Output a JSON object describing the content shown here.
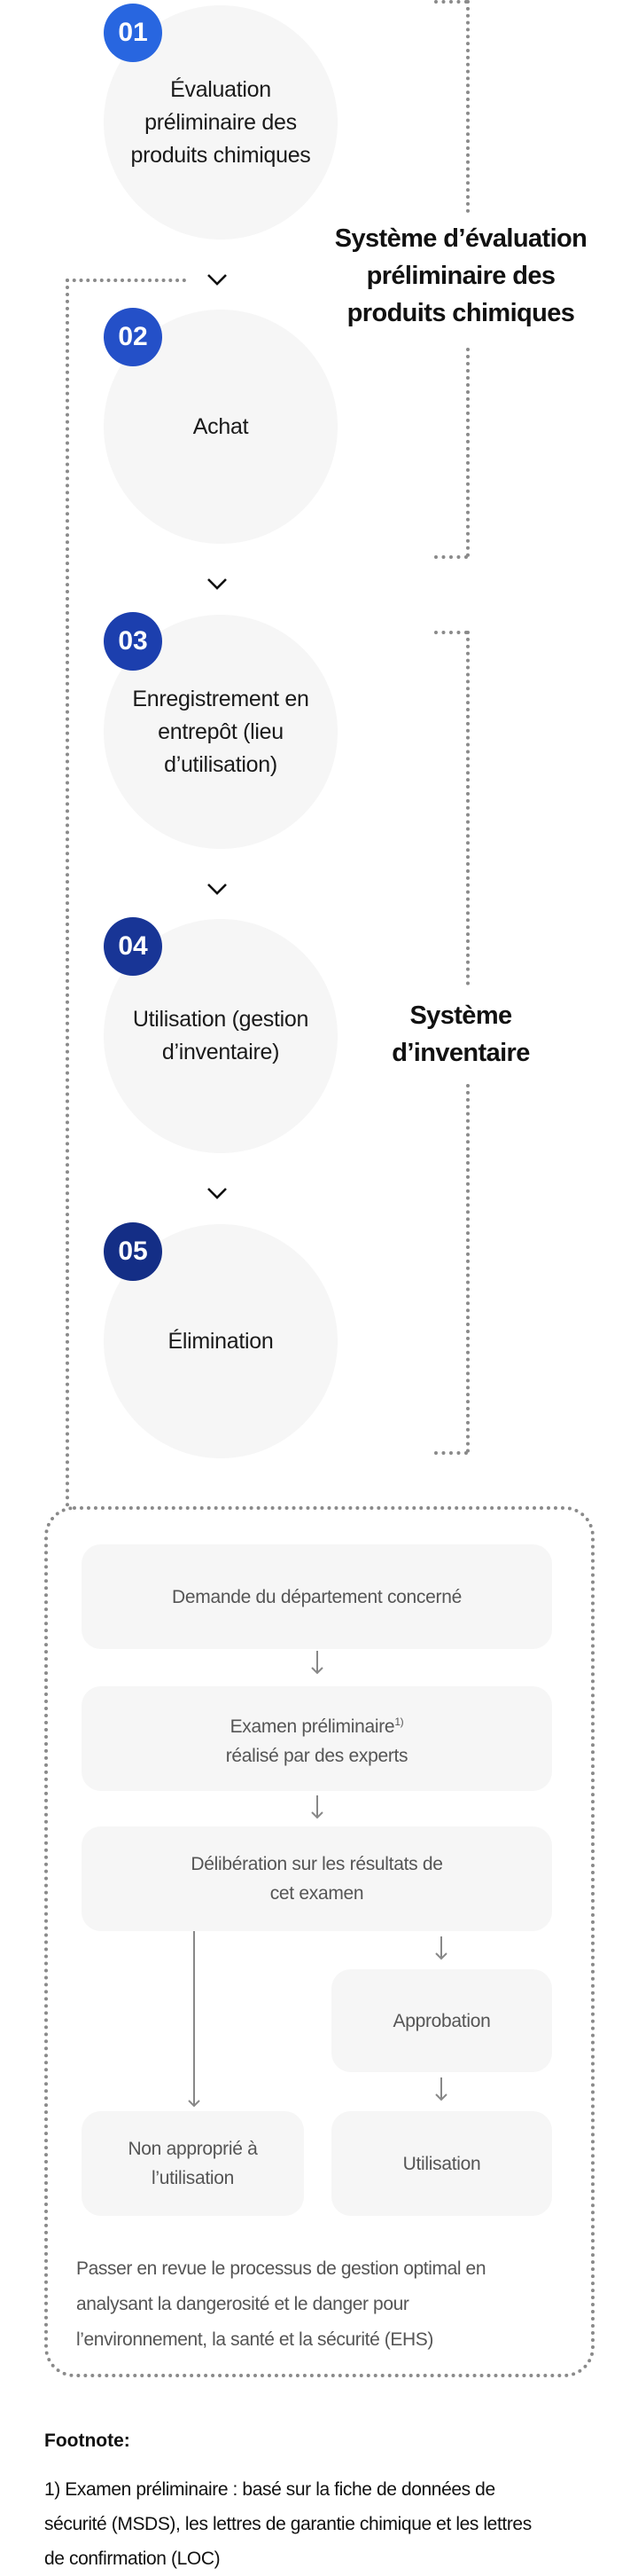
{
  "colors": {
    "badge_1": "#2866e0",
    "badge_2": "#2450c8",
    "badge_3": "#1c3fae",
    "badge_4": "#183596",
    "badge_5": "#142e86",
    "circle_bg": "#f6f6f6",
    "dots": "#8a8a8a"
  },
  "steps": [
    {
      "number": "01",
      "label": "Évaluation préliminaire des produits chimiques"
    },
    {
      "number": "02",
      "label": "Achat"
    },
    {
      "number": "03",
      "label": "Enregistrement en entrepôt (lieu d’utilisation)"
    },
    {
      "number": "04",
      "label": "Utilisation (gestion d’inventaire)"
    },
    {
      "number": "05",
      "label": "Élimination"
    }
  ],
  "systems": {
    "evaluation": "Système d’évaluation préliminaire des produits chimiques",
    "inventory": "Système d’inventaire"
  },
  "process": {
    "request": "Demande du département concerné",
    "review": "Examen préliminaire",
    "review_sup": "1)",
    "review_line2": "réalisé par des experts",
    "deliberation": "Délibération sur les résultats de cet examen",
    "approval": "Approbation",
    "not_suitable": "Non approprié à l’utilisation",
    "use": "Utilisation",
    "description": "Passer en revue le processus de gestion optimal en analysant la dangerosité et le danger pour l’environnement, la santé et la sécurité (EHS)"
  },
  "footnote": {
    "title": "Footnote:",
    "text": "1) Examen préliminaire : basé sur la fiche de données de sécurité (MSDS), les lettres de garantie chimique et les lettres de confirmation (LOC)"
  }
}
